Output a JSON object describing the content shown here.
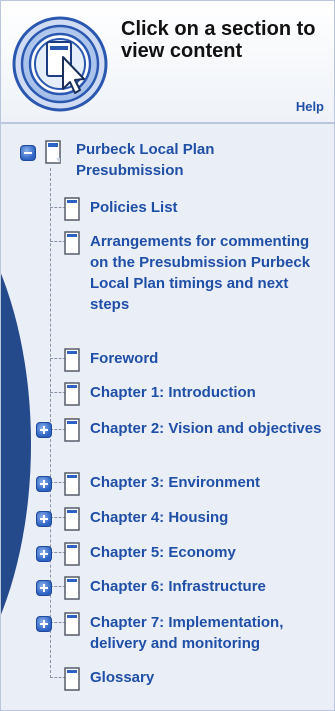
{
  "header": {
    "icon": "cursor-on-screen-icon",
    "instruction": "Click on a section to view content",
    "help_label": "Help"
  },
  "colors": {
    "link_blue": "#1f4fa6",
    "tree_background": "#e9eef7",
    "accent_dark_blue": "#244a8c",
    "button_blue": "#2b62c3"
  },
  "tree": {
    "root": {
      "label": "Purbeck Local Plan Presubmission",
      "state": "expanded",
      "icon": "document-icon"
    },
    "items": [
      {
        "label": "Policies List",
        "expandable": false
      },
      {
        "label": "Arrangements for commenting on the Presubmission Purbeck Local Plan timings and next steps",
        "expandable": false
      },
      {
        "label": "Foreword",
        "expandable": false
      },
      {
        "label": "Chapter 1: Introduction",
        "expandable": false
      },
      {
        "label": "Chapter 2: Vision and objectives",
        "expandable": true
      },
      {
        "label": "Chapter 3: Environment",
        "expandable": true
      },
      {
        "label": "Chapter 4: Housing",
        "expandable": true
      },
      {
        "label": "Chapter 5: Economy",
        "expandable": true
      },
      {
        "label": "Chapter 6: Infrastructure",
        "expandable": true
      },
      {
        "label": "Chapter 7: Implementation, delivery and monitoring",
        "expandable": true
      },
      {
        "label": "Glossary",
        "expandable": false
      }
    ]
  }
}
